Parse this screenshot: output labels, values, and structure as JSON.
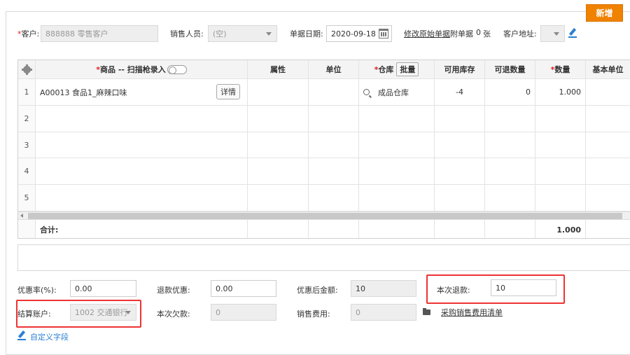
{
  "toolbar": {
    "new_label": "新增"
  },
  "header": {
    "customer_label": "客户:",
    "customer_value": "888888 零售客户",
    "salesperson_label": "销售人员:",
    "salesperson_value": "(空)",
    "date_label": "单据日期:",
    "date_value": "2020-09-18",
    "modify_original_link": "修改原始单据",
    "attach_label": "附单据",
    "attach_count": "0",
    "attach_unit": "张",
    "address_label": "客户地址:"
  },
  "grid": {
    "columns": [
      "商品 -- 扫描枪录入",
      "属性",
      "单位",
      "仓库",
      "可用库存",
      "可退数量",
      "数量",
      "基本单位"
    ],
    "batch_label": "批量",
    "detail_label": "详情",
    "rows": [
      {
        "no": "1",
        "product": "A00013 食品1_麻辣口味",
        "warehouse": "成品仓库",
        "available": "-4",
        "returnable": "0",
        "qty": "1.000"
      },
      {
        "no": "2"
      },
      {
        "no": "3"
      },
      {
        "no": "4"
      },
      {
        "no": "5"
      }
    ],
    "total_label": "合计:",
    "total_qty": "1.000"
  },
  "footer": {
    "discount_rate_label": "优惠率(%):",
    "discount_rate_value": "0.00",
    "refund_discount_label": "退款优惠:",
    "refund_discount_value": "0.00",
    "after_discount_label": "优惠后金额:",
    "after_discount_value": "10",
    "this_refund_label": "本次退款:",
    "this_refund_value": "10",
    "account_label": "结算账户:",
    "account_value": "1002 交通银行",
    "this_owed_label": "本次欠款:",
    "this_owed_value": "0",
    "sales_fee_label": "销售费用:",
    "sales_fee_value": "0",
    "purchase_fee_link": "采购销售费用清单",
    "custom_fields_link": "自定义字段"
  }
}
